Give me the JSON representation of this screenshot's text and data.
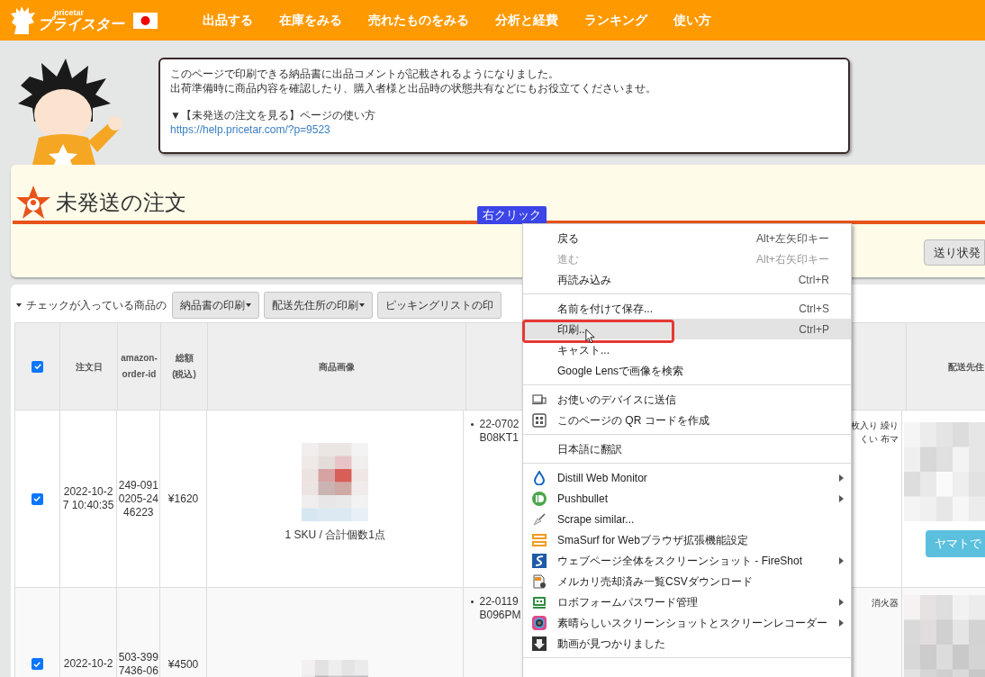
{
  "header": {
    "logo_small": "pricetar",
    "logo": "プライスター",
    "nav": [
      "出品する",
      "在庫をみる",
      "売れたものをみる",
      "分析と経費",
      "ランキング",
      "使い方"
    ]
  },
  "notice": {
    "lines": [
      "このページで印刷できる納品書に出品コメントが記載されるようになりました。",
      "出荷準備時に商品内容を確認したり、購入者様と出品時の状態共有などにもお役立てくださいませ。"
    ],
    "guide": "▼【未発送の注文を見る】ページの使い方",
    "link": "https://help.pricetar.com/?p=9523"
  },
  "page_title": "未発送の注文",
  "annotation_label": "右クリック",
  "side_button": "送り状発",
  "toolbar": {
    "label": "チェックが入っている商品の",
    "buttons": [
      {
        "label": "納品書の印刷",
        "dropdown": true
      },
      {
        "label": "配送先住所の印刷",
        "dropdown": true
      },
      {
        "label": "ピッキングリストの印",
        "dropdown": false
      }
    ]
  },
  "table": {
    "select_all": {
      "checked": true
    },
    "headers": {
      "order_date": "注文日",
      "order_id": "amazon-order-id",
      "total": "総額(税込)",
      "image": "商品画像",
      "shipping": "配送先住"
    },
    "rows": [
      {
        "checked": true,
        "order_date": "2022-10-27 10:40:35",
        "order_id": "249-0910205-2446223",
        "total": "¥1620",
        "image": {
          "kind": "picture"
        },
        "sku_summary": "1 SKU / 合計個数1点",
        "item_lines": [
          "22-0702",
          "B08KT1"
        ],
        "title_fragment": [
          "枚入り 繰り",
          "くい 布マ"
        ],
        "shipping_button": "ヤマトで"
      },
      {
        "checked": true,
        "order_date": "2022-10-2",
        "order_id": "503-3997436-06",
        "total": "¥4500",
        "image": {
          "kind": "picture"
        },
        "item_lines": [
          "22-0119",
          "B096PM"
        ],
        "title_fragment": [
          "消火器"
        ]
      }
    ]
  },
  "context_menu": {
    "groups": [
      [
        {
          "label": "戻る",
          "shortcut": "Alt+左矢印キー",
          "disabled": false,
          "selected": false
        },
        {
          "label": "進む",
          "shortcut": "Alt+右矢印キー",
          "disabled": true,
          "selected": false
        },
        {
          "label": "再読み込み",
          "shortcut": "Ctrl+R",
          "disabled": false,
          "selected": false
        }
      ],
      [
        {
          "label": "名前を付けて保存...",
          "shortcut": "Ctrl+S",
          "disabled": false,
          "selected": false
        },
        {
          "label": "印刷...",
          "shortcut": "Ctrl+P",
          "disabled": false,
          "selected": true
        },
        {
          "label": "キャスト...",
          "disabled": false,
          "selected": false
        },
        {
          "label": "Google Lensで画像を検索",
          "disabled": false,
          "selected": false
        }
      ],
      [
        {
          "label": "お使いのデバイスに送信",
          "kind": "device",
          "disabled": false,
          "selected": false
        },
        {
          "label": "このページの QR コードを作成",
          "kind": "qr",
          "disabled": false,
          "selected": false
        }
      ],
      [
        {
          "label": "日本語に翻訳",
          "disabled": false,
          "selected": false
        }
      ],
      [
        {
          "label": "Distill Web Monitor",
          "kind": "drop",
          "submenu": true,
          "disabled": false,
          "selected": false
        },
        {
          "label": "Pushbullet",
          "kind": "pushbullet",
          "submenu": true,
          "disabled": false,
          "selected": false
        },
        {
          "label": "Scrape similar...",
          "kind": "scraper",
          "submenu": false,
          "disabled": false,
          "selected": false
        },
        {
          "label": "SmaSurf for Webブラウザ拡張機能設定",
          "kind": "smasurf",
          "submenu": false,
          "disabled": false,
          "selected": false
        },
        {
          "label": "ウェブページ全体をスクリーンショット - FireShot",
          "kind": "fireshot",
          "submenu": true,
          "disabled": false,
          "selected": false
        },
        {
          "label": "メルカリ売却済み一覧CSVダウンロード",
          "kind": "csv",
          "submenu": false,
          "disabled": false,
          "selected": false
        },
        {
          "label": "ロボフォームパスワード管理",
          "kind": "roboform",
          "submenu": true,
          "disabled": false,
          "selected": false
        },
        {
          "label": "素晴らしいスクリーンショットとスクリーンレコーダー",
          "kind": "camera",
          "submenu": true,
          "disabled": false,
          "selected": false
        },
        {
          "label": "動画が見つかりました",
          "kind": "download",
          "submenu": false,
          "disabled": false,
          "selected": false
        }
      ]
    ]
  }
}
